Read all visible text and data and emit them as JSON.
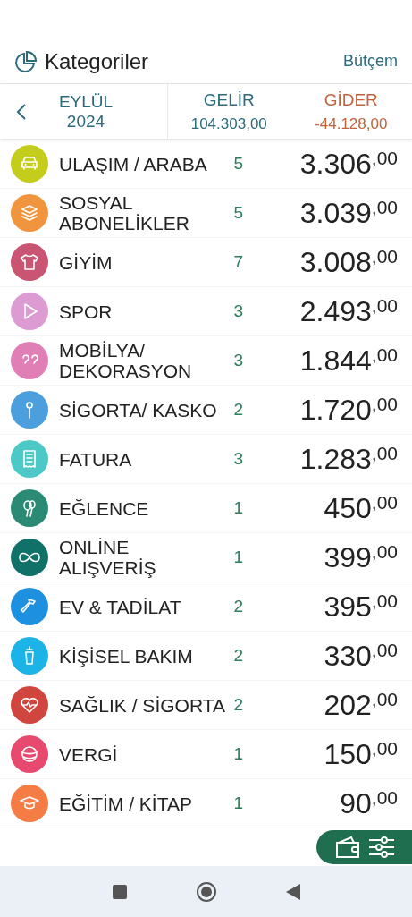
{
  "header": {
    "title": "Kategoriler",
    "budget_link": "Bütçem"
  },
  "summary": {
    "period": "EYLÜL 2024",
    "income_label": "GELİR",
    "income": "104.303,00",
    "expense_label": "GİDER",
    "expense": "-44.128,00"
  },
  "categories": [
    {
      "name": "ULAŞIM / ARABA",
      "count": "5",
      "amount": "3.306",
      "decimals": ",00",
      "color": "#c4cc1c"
    },
    {
      "name": "SOSYAL ABONELİKLER",
      "count": "5",
      "amount": "3.039",
      "decimals": ",00",
      "color": "#f0953e"
    },
    {
      "name": "GİYİM",
      "count": "7",
      "amount": "3.008",
      "decimals": ",00",
      "color": "#c95573"
    },
    {
      "name": "SPOR",
      "count": "3",
      "amount": "2.493",
      "decimals": ",00",
      "color": "#dc9bd3"
    },
    {
      "name": "MOBİLYA/ DEKORASYON",
      "count": "3",
      "amount": "1.844",
      "decimals": ",00",
      "color": "#e07fb5"
    },
    {
      "name": "SİGORTA/ KASKO",
      "count": "2",
      "amount": "1.720",
      "decimals": ",00",
      "color": "#4a9fdc"
    },
    {
      "name": "FATURA",
      "count": "3",
      "amount": "1.283",
      "decimals": ",00",
      "color": "#4cc8c6"
    },
    {
      "name": "EĞLENCE",
      "count": "1",
      "amount": "450",
      "decimals": ",00",
      "color": "#2a8a74"
    },
    {
      "name": "ONLİNE ALIŞVERİŞ",
      "count": "1",
      "amount": "399",
      "decimals": ",00",
      "color": "#0f7168"
    },
    {
      "name": "EV & TADİLAT",
      "count": "2",
      "amount": "395",
      "decimals": ",00",
      "color": "#1e90e0"
    },
    {
      "name": "KİŞİSEL BAKIM",
      "count": "2",
      "amount": "330",
      "decimals": ",00",
      "color": "#1cb4e6"
    },
    {
      "name": "SAĞLIK / SİGORTA",
      "count": "2",
      "amount": "202",
      "decimals": ",00",
      "color": "#d0463f"
    },
    {
      "name": "VERGİ",
      "count": "1",
      "amount": "150",
      "decimals": ",00",
      "color": "#e84a6f"
    },
    {
      "name": "EĞİTİM / KİTAP",
      "count": "1",
      "amount": "90",
      "decimals": ",00",
      "color": "#f57c45"
    }
  ]
}
